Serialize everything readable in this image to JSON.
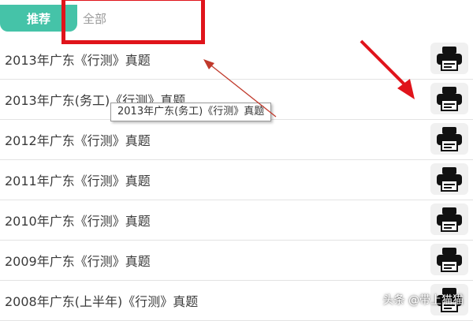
{
  "tabs": {
    "recommended": "推荐",
    "all": "全部"
  },
  "list": {
    "items": [
      {
        "title": "2013年广东《行测》真题"
      },
      {
        "title": "2013年广东(务工)《行测》真题"
      },
      {
        "title": "2012年广东《行测》真题"
      },
      {
        "title": "2011年广东《行测》真题"
      },
      {
        "title": "2010年广东《行测》真题"
      },
      {
        "title": "2009年广东《行测》真题"
      },
      {
        "title": "2008年广东(上半年)《行测》真题"
      }
    ]
  },
  "tooltip": {
    "text": "2013年广东(务工)《行测》真题"
  },
  "watermark": {
    "text": "头条 @带上猫猫"
  },
  "colors": {
    "accent": "#45c3a8",
    "highlight_red": "#e0141b",
    "print_icon": "#111111"
  },
  "icons": {
    "print": "printer-icon"
  }
}
